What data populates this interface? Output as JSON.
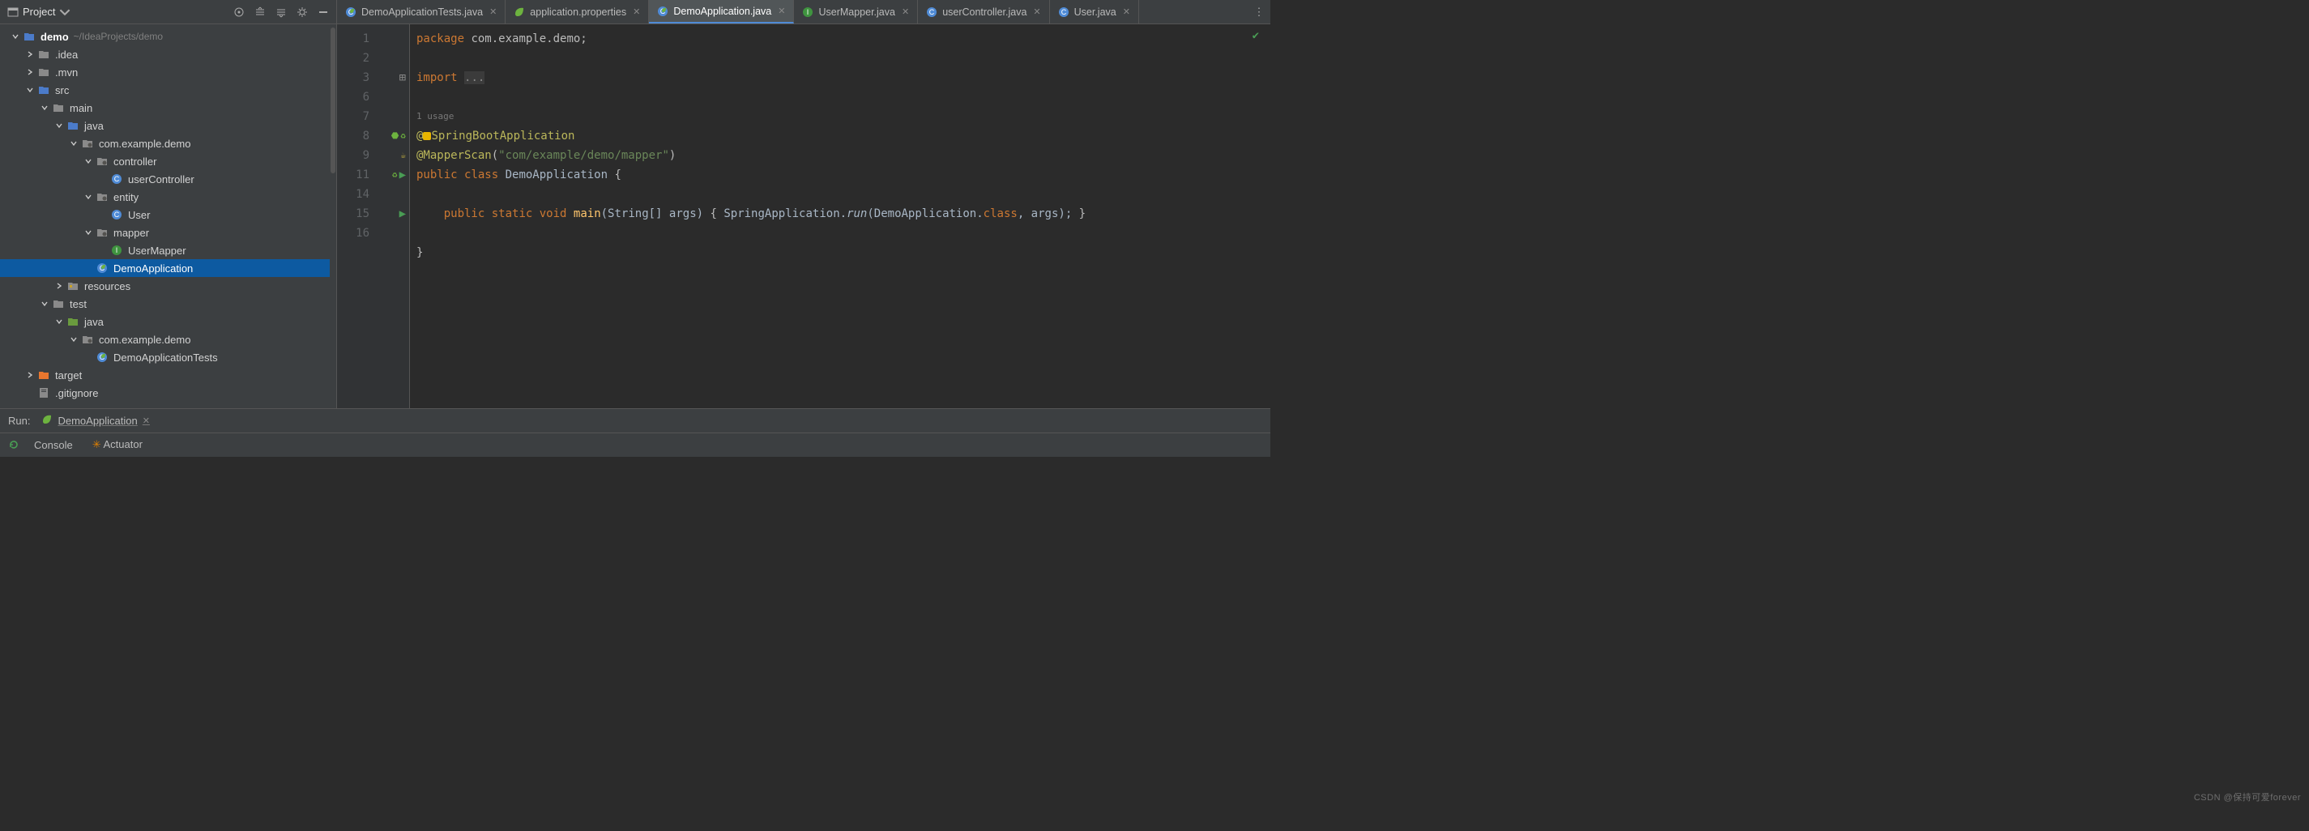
{
  "sidebar": {
    "title": "Project",
    "project_name": "demo",
    "project_path": "~/IdeaProjects/demo",
    "nodes": [
      {
        "indent": 0,
        "arrow": "down",
        "icon": "folder-blue",
        "name": "demo",
        "bold": true,
        "path": "~/IdeaProjects/demo"
      },
      {
        "indent": 1,
        "arrow": "right",
        "icon": "folder-dark",
        "name": ".idea"
      },
      {
        "indent": 1,
        "arrow": "right",
        "icon": "folder-dark",
        "name": ".mvn"
      },
      {
        "indent": 1,
        "arrow": "down",
        "icon": "folder-blue",
        "name": "src"
      },
      {
        "indent": 2,
        "arrow": "down",
        "icon": "folder-dark",
        "name": "main"
      },
      {
        "indent": 3,
        "arrow": "down",
        "icon": "folder-blue",
        "name": "java"
      },
      {
        "indent": 4,
        "arrow": "down",
        "icon": "package",
        "name": "com.example.demo"
      },
      {
        "indent": 5,
        "arrow": "down",
        "icon": "package",
        "name": "controller"
      },
      {
        "indent": 6,
        "arrow": "none",
        "icon": "class-blue",
        "name": "userController"
      },
      {
        "indent": 5,
        "arrow": "down",
        "icon": "package",
        "name": "entity"
      },
      {
        "indent": 6,
        "arrow": "none",
        "icon": "class-blue",
        "name": "User"
      },
      {
        "indent": 5,
        "arrow": "down",
        "icon": "package",
        "name": "mapper"
      },
      {
        "indent": 6,
        "arrow": "none",
        "icon": "class-green",
        "name": "UserMapper"
      },
      {
        "indent": 5,
        "arrow": "none",
        "icon": "class-spring",
        "name": "DemoApplication",
        "selected": true
      },
      {
        "indent": 3,
        "arrow": "right",
        "icon": "folder-res",
        "name": "resources"
      },
      {
        "indent": 2,
        "arrow": "down",
        "icon": "folder-dark",
        "name": "test"
      },
      {
        "indent": 3,
        "arrow": "down",
        "icon": "folder-green",
        "name": "java"
      },
      {
        "indent": 4,
        "arrow": "down",
        "icon": "package",
        "name": "com.example.demo"
      },
      {
        "indent": 5,
        "arrow": "none",
        "icon": "class-spring",
        "name": "DemoApplicationTests"
      },
      {
        "indent": 1,
        "arrow": "right",
        "icon": "folder-orange",
        "name": "target"
      },
      {
        "indent": 1,
        "arrow": "none",
        "icon": "gitignore",
        "name": ".gitignore"
      }
    ]
  },
  "tabs": [
    {
      "label": "DemoApplicationTests.java",
      "icon": "class-spring",
      "active": false
    },
    {
      "label": "application.properties",
      "icon": "spring-leaf",
      "active": false
    },
    {
      "label": "DemoApplication.java",
      "icon": "class-spring",
      "active": true
    },
    {
      "label": "UserMapper.java",
      "icon": "class-green",
      "active": false
    },
    {
      "label": "userController.java",
      "icon": "class-blue",
      "active": false
    },
    {
      "label": "User.java",
      "icon": "class-blue",
      "active": false
    }
  ],
  "editor": {
    "line_numbers": [
      "1",
      "2",
      "3",
      "6",
      "",
      "7",
      "8",
      "9",
      "",
      "11",
      "14",
      "15",
      "16"
    ],
    "usage_hint": "1 usage",
    "code": {
      "l1_package": "package ",
      "l1_pkgname": "com.example.demo",
      "l1_end": ";",
      "l3_import": "import ",
      "l3_dots": "...",
      "l7_at": "@",
      "l7_ann": "SpringBootApplication",
      "l8_at": "@MapperScan",
      "l8_open": "(",
      "l8_str": "\"com/example/demo/mapper\"",
      "l8_close": ")",
      "l9_public": "public ",
      "l9_class": "class ",
      "l9_name": "DemoApplication ",
      "l9_br": "{",
      "l11_indent": "    ",
      "l11_pub": "public ",
      "l11_static": "static ",
      "l11_void": "void ",
      "l11_main": "main",
      "l11_args": "(String[] args) ",
      "l11_bro": "{ ",
      "l11_call": "SpringApplication.",
      "l11_run": "run",
      "l11_par": "(DemoApplication.",
      "l11_class": "class",
      "l11_rest": ", args); ",
      "l11_brc": "}",
      "l15": "}"
    }
  },
  "run": {
    "label": "Run:",
    "config": "DemoApplication",
    "sub_console": "Console",
    "sub_actuator": "Actuator"
  },
  "watermark": "CSDN @保持可爱forever"
}
